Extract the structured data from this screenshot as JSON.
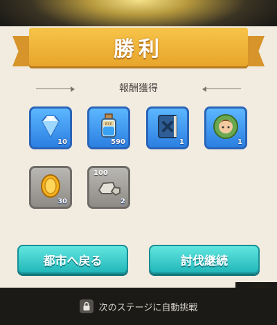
{
  "banner": {
    "title": "勝利"
  },
  "rewards": {
    "heading": "報酬獲得",
    "items": [
      {
        "icon": "gem-icon",
        "count": "10"
      },
      {
        "icon": "potion-bottle-icon",
        "count": "590"
      },
      {
        "icon": "spellbook-icon",
        "count": "1"
      },
      {
        "icon": "hero-portrait-icon",
        "count": "1"
      },
      {
        "icon": "gold-coin-icon",
        "count": "30"
      },
      {
        "icon": "stone-ore-icon",
        "count": "2",
        "top_count": "100"
      }
    ]
  },
  "buttons": {
    "return_city": "都市へ戻る",
    "continue_hunt": "討伐継続"
  },
  "footer": {
    "auto_battle_text": "次のステージに自動挑戦"
  },
  "colors": {
    "banner": "#eeb33a",
    "panel": "#f1ebe0",
    "tile_blue": "#3d95f0",
    "tile_gray": "#a3a09b",
    "button": "#34c8c8",
    "background": "#1b1a17"
  }
}
